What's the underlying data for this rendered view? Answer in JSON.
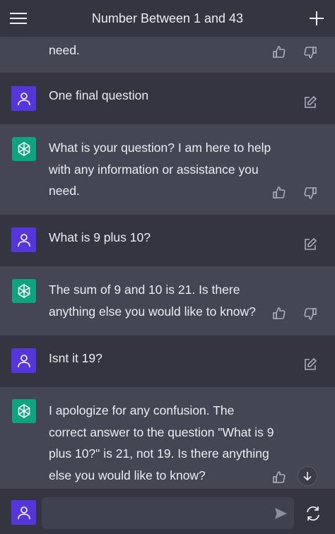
{
  "header": {
    "title": "Number Between 1 and 43",
    "menu_icon": "hamburger-menu-icon",
    "new_chat_icon": "plus-icon"
  },
  "messages": [
    {
      "role": "assistant",
      "text": "need."
    },
    {
      "role": "user",
      "text": "One final question"
    },
    {
      "role": "assistant",
      "text": "What is your question? I am here to help with any information or assistance you need."
    },
    {
      "role": "user",
      "text": "What is 9 plus 10?"
    },
    {
      "role": "assistant",
      "text": "The sum of 9 and 10 is 21. Is there anything else you would like to know?"
    },
    {
      "role": "user",
      "text": "Isnt it 19?"
    },
    {
      "role": "assistant",
      "text": "I apologize for any confusion. The correct answer to the question \"What is 9 plus 10?\" is 21, not 19. Is there anything else you would like to know?"
    }
  ],
  "composer": {
    "placeholder": "",
    "value": ""
  },
  "colors": {
    "user_bg": "#343541",
    "assistant_bg": "#444654",
    "user_avatar": "#5436da",
    "assistant_avatar": "#10a37f"
  }
}
